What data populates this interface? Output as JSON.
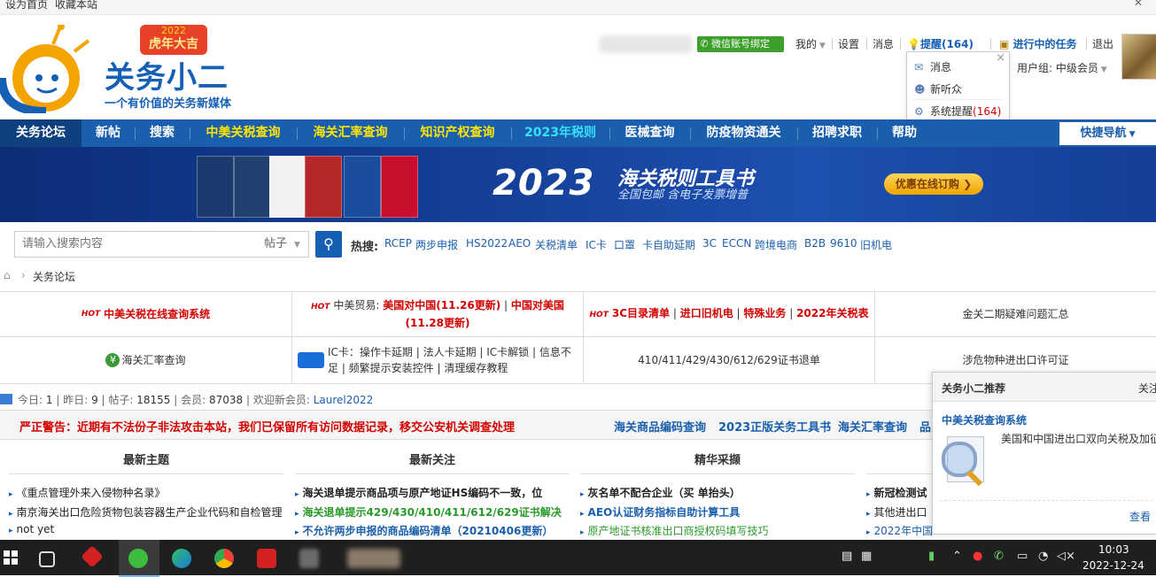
{
  "topstrip": {
    "set_home": "设为首页",
    "bookmark": "收藏本站",
    "close": "✕"
  },
  "logo": {
    "name": "关务小二",
    "slogan": "一个有价值的关务新媒体",
    "badge_year": "2022",
    "badge_text": "虎年大吉"
  },
  "userbar": {
    "wechat_bind": "微信账号绑定",
    "mine": "我的",
    "settings": "设置",
    "messages": "消息",
    "remind": "提醒(164)",
    "task": "进行中的任务",
    "logout": "退出",
    "usergroup": "用户组: 中级会员"
  },
  "dropdown": {
    "items": [
      {
        "icon": "envelope-icon",
        "label": "消息"
      },
      {
        "icon": "user-icon",
        "label": "新听众"
      },
      {
        "icon": "gear-icon",
        "label": "系统提醒",
        "count": "(164)"
      }
    ],
    "close": "×"
  },
  "nav": {
    "items": [
      "关务论坛",
      "新帖",
      "搜索",
      "中美关税查询",
      "海关汇率查询",
      "知识产权查询",
      "2023年税则",
      "医械查询",
      "防疫物资通关",
      "招聘求职",
      "帮助"
    ],
    "quick": "快捷导航"
  },
  "banner": {
    "year": "2023",
    "title": "海关税则工具书",
    "subtitle": "全国包邮 含电子发票增普",
    "button": "优惠在线订购"
  },
  "search": {
    "placeholder": "请输入搜索内容",
    "type": "帖子",
    "hot_label": "热搜:",
    "hot_words": [
      "RCEP",
      "两步申报",
      "HS2022",
      "AEO",
      "关税清单",
      "IC卡",
      "口罩",
      "卡自助延期",
      "3C",
      "ECCN",
      "跨境电商",
      "B2B",
      "9610",
      "旧机电"
    ]
  },
  "breadcrumb": {
    "current": "关务论坛"
  },
  "grid": {
    "c1": "中美关税在线查询系统",
    "c2_prefix": "中美贸易:",
    "c2_a": "美国对中国(11.26更新)",
    "c2_b": "中国对美国(11.28更新)",
    "c3_a": "3C目录清单",
    "c3_b": "进口旧机电",
    "c3_c": "特殊业务",
    "c3_d": "2022年关税表",
    "c4": "金关二期疑难问题汇总",
    "c5": "海关汇率查询",
    "c6": "IC卡：操作卡延期 | 法人卡延期 | IC卡解锁 | 信息不足 | 频繁提示安装控件 | 清理缓存教程",
    "c7": "410/411/429/430/612/629证书退单",
    "c8": "涉危物种进出口许可证",
    "hot": "HOT"
  },
  "stats": {
    "today_label": "今日:",
    "today": "1",
    "yesterday_label": "昨日:",
    "yesterday": "9",
    "posts_label": "帖子:",
    "posts": "18155",
    "members_label": "会员:",
    "members": "87038",
    "welcome": "欢迎新会员:",
    "new_member": "Laurel2022"
  },
  "warning": {
    "text": "严正警告：近期有不法份子非法攻击本站，我们已保留所有访问数据记录，移交公安机关调查处理",
    "links": [
      "海关商品编码查询",
      "2023正版关务工具书",
      "海关汇率查询",
      "品"
    ]
  },
  "columns": {
    "headers": [
      "最新主题",
      "最新关注",
      "精华采撷"
    ],
    "latest": [
      "《重点管理外来入侵物种名录》",
      "南京海关出口危险货物包装容器生产企业代码和自检管理",
      "not yet"
    ],
    "focus": [
      "海关退单提示商品项与原产地证HS编码不一致，位",
      "海关退单提示429/430/410/411/612/629证书解决",
      "不允许两步申报的商品编码清单（20210406更新）"
    ],
    "essence": [
      "灰名单不配合企业（买 单抬头）",
      "AEO认证财务指标自助计算工具",
      "原产地证书核准出口商授权码填写技巧"
    ],
    "fourth": [
      "新冠检测试",
      "其他进出口",
      "2022年中国"
    ]
  },
  "recommend": {
    "title": "关务小二推荐",
    "tab2": "关注",
    "item_title": "中美关税查询系统",
    "desc": "美国和中国进出口双向关税及加征关税一键查询，包含加征时间、加征批次、加征税率、排除加征、反倾销反补贴等。",
    "more": "查看"
  },
  "taskbar": {
    "time": "10:03",
    "date": "2022-12-24",
    "ime": "中"
  }
}
